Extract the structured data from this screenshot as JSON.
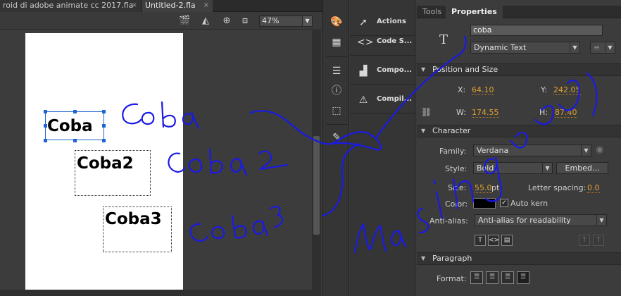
{
  "document_tabs": [
    {
      "label": "roid di adobe animate cc 2017.fla",
      "close": "×"
    },
    {
      "label": "Untitled-2.fla",
      "close": "×"
    }
  ],
  "stage_toolbar": {
    "zoom_value": "47%",
    "icons": [
      "clapper-icon",
      "paint-bucket-icon",
      "center-stage-icon",
      "clip-icon"
    ]
  },
  "stage": {
    "texts": [
      "Coba",
      "Coba2",
      "Coba3"
    ]
  },
  "dock_icons": [
    "palette-icon",
    "grid-icon",
    "align-icon",
    "info-icon",
    "transform-icon",
    "brush-icon"
  ],
  "panel_list": [
    {
      "label": "Actions",
      "icon": "actions-icon"
    },
    {
      "label": "Code S...",
      "icon": "code-snippets-icon"
    },
    {
      "label": "Compo...",
      "icon": "components-icon"
    },
    {
      "label": "Compil...",
      "icon": "compiler-errors-icon"
    }
  ],
  "properties": {
    "tabs": [
      "Tools",
      "Properties"
    ],
    "instance_name": "coba",
    "text_type": "Dynamic Text",
    "position_size": {
      "header": "Position and Size",
      "x_label": "X:",
      "x": "64.10",
      "y_label": "Y:",
      "y": "242.05",
      "w_label": "W:",
      "w": "174.55",
      "h_label": "H:",
      "h": "87.40"
    },
    "character": {
      "header": "Character",
      "family_label": "Family:",
      "family": "Verdana",
      "style_label": "Style:",
      "style": "Bold",
      "embed": "Embed...",
      "size_label": "Size:",
      "size": "55.0",
      "size_unit": "pt",
      "spacing_label": "Letter spacing:",
      "spacing": "0.0",
      "color_label": "Color:",
      "color_value": "#000000",
      "autokern_label": "Auto kern",
      "antialias_label": "Anti-alias:",
      "antialias": "Anti-alias for readability"
    },
    "paragraph": {
      "header": "Paragraph",
      "format_label": "Format:"
    }
  },
  "annotations": [
    "Coba",
    "Coba2",
    "Coba3",
    "masing"
  ]
}
